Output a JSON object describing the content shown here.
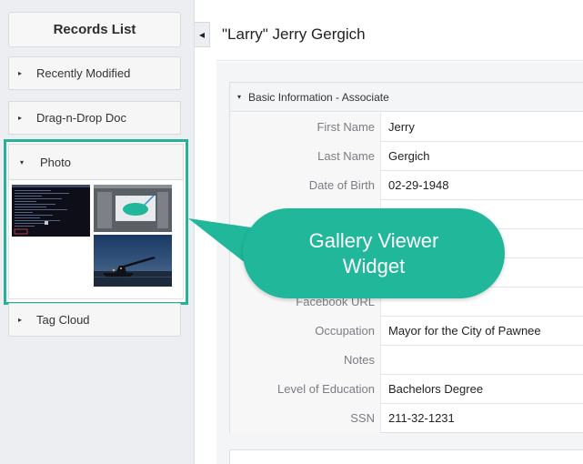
{
  "sidebar": {
    "heading": "Records List",
    "panels": [
      {
        "label": "Recently Modified"
      },
      {
        "label": "Drag-n-Drop Doc"
      },
      {
        "label": "Photo"
      },
      {
        "label": "Tag Cloud"
      }
    ],
    "collapsed_glyph": "▸",
    "expanded_glyph": "▾"
  },
  "collapse_button": {
    "glyph": "◂"
  },
  "record": {
    "title": "\"Larry\" Jerry Gergich"
  },
  "section": {
    "title": "Basic Information - Associate",
    "rows": [
      {
        "label": "First Name",
        "value": "Jerry"
      },
      {
        "label": "Last Name",
        "value": "Gergich"
      },
      {
        "label": "Date of Birth",
        "value": "02-29-1948"
      },
      {
        "label": "",
        "value": ""
      },
      {
        "label": "",
        "value": ""
      },
      {
        "label": "Facebook URL",
        "value": ""
      },
      {
        "label": "Occupation",
        "value": "Mayor for the City of Pawnee"
      },
      {
        "label": "Notes",
        "value": ""
      },
      {
        "label": "Level of Education",
        "value": "Bachelors Degree"
      },
      {
        "label": "SSN",
        "value": "211-32-1231"
      }
    ]
  },
  "callout": {
    "line1": "Gallery Viewer",
    "line2": "Widget"
  },
  "colors": {
    "accent": "#21b79b",
    "highlight_border": "#26b297"
  }
}
